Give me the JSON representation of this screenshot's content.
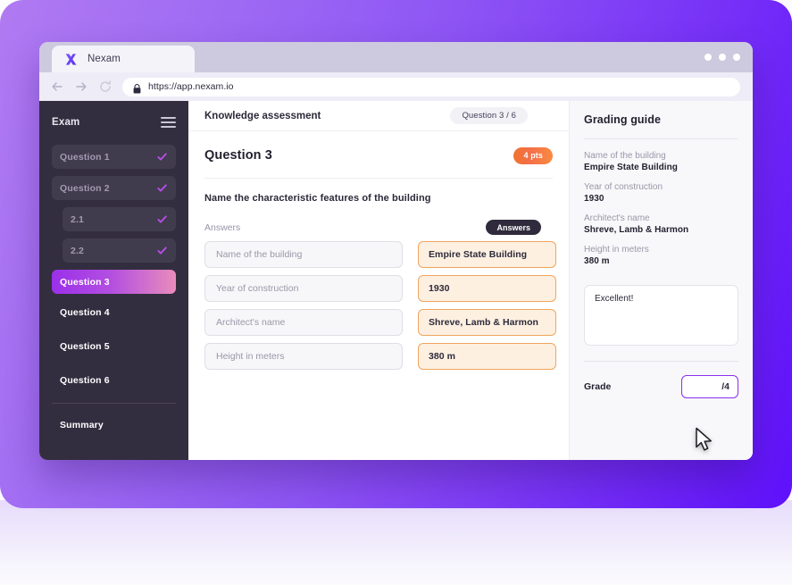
{
  "browser": {
    "tab": {
      "title": "Nexam",
      "logo_icon": "nexam-x-logo"
    },
    "window_controls": [
      "dot",
      "dot",
      "dot"
    ],
    "nav": {
      "back_icon": "arrow-left-icon",
      "forward_icon": "arrow-right-icon",
      "reload_icon": "reload-icon"
    },
    "address": {
      "lock_icon": "lock-icon",
      "url": "https://app.nexam.io"
    }
  },
  "sidebar": {
    "title": "Exam",
    "menu_icon": "hamburger-icon",
    "items": [
      {
        "label": "Question 1",
        "state": "done",
        "check_icon": "check-icon"
      },
      {
        "label": "Question 2",
        "state": "done",
        "check_icon": "check-icon"
      },
      {
        "label": "2.1",
        "state": "sub",
        "check_icon": "check-icon"
      },
      {
        "label": "2.2",
        "state": "sub",
        "check_icon": "check-icon"
      },
      {
        "label": "Question 3",
        "state": "active"
      },
      {
        "label": "Question 4",
        "state": "plain"
      },
      {
        "label": "Question 5",
        "state": "plain"
      },
      {
        "label": "Question 6",
        "state": "plain"
      }
    ],
    "footer_item": {
      "label": "Summary"
    }
  },
  "main": {
    "header_title": "Knowledge assessment",
    "progress_pill": "Question 3 / 6",
    "question_title": "Question 3",
    "points_badge": "4 pts",
    "prompt": "Name the characteristic features of the building",
    "answers_label": "Answers",
    "answers_chip": "Answers",
    "rows": [
      {
        "label": "Name of the building",
        "answer": "Empire State Building"
      },
      {
        "label": "Year of construction",
        "answer": "1930"
      },
      {
        "label": "Architect's name",
        "answer": "Shreve, Lamb & Harmon"
      },
      {
        "label": "Height in meters",
        "answer": "380 m"
      }
    ]
  },
  "guide": {
    "title": "Grading guide",
    "entries": [
      {
        "key": "Name of the building",
        "value": "Empire State Building"
      },
      {
        "key": "Year of construction",
        "value": "1930"
      },
      {
        "key": "Architect's name",
        "value": "Shreve, Lamb & Harmon"
      },
      {
        "key": "Height in meters",
        "value": "380 m"
      }
    ],
    "comment": "Excellent!",
    "grade_label": "Grade",
    "grade_value": "/4"
  },
  "cursor": {
    "icon": "mouse-pointer-icon"
  },
  "colors": {
    "brand_purple": "#8b2df0",
    "accent_orange": "#f0722e",
    "sidebar_bg": "#332e3f",
    "active_gradient_start": "#9b30ea",
    "active_gradient_end": "#e98cbc",
    "answer_border": "#f0a55e",
    "answer_bg": "#fdf0e1"
  }
}
